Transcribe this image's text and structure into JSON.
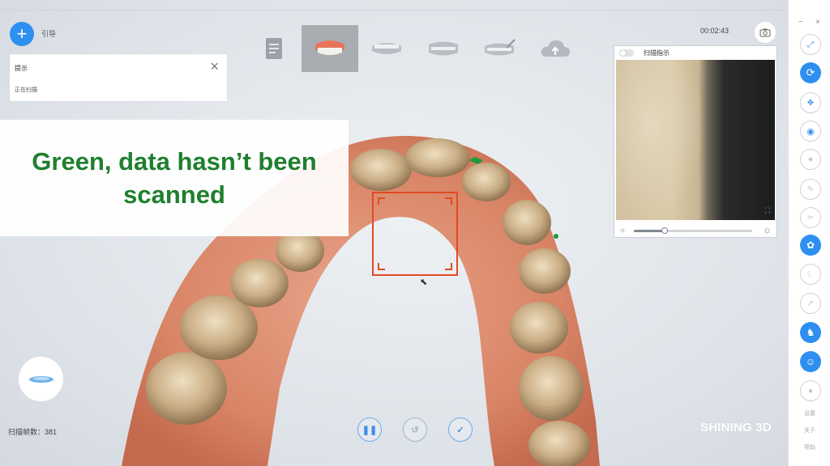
{
  "app": {
    "guide_label": "引导",
    "timer": "00:02:43",
    "brand": "SHINING 3D",
    "frame_count_label": "扫描帧数：",
    "frame_count_value": "381"
  },
  "hint_panel": {
    "title": "提示",
    "body": "正在扫描"
  },
  "caption": {
    "text": "Green, data hasn’t been scanned"
  },
  "steps": [
    {
      "name": "order-info",
      "active": false
    },
    {
      "name": "upper-jaw",
      "active": true
    },
    {
      "name": "lower-jaw",
      "active": false
    },
    {
      "name": "bite",
      "active": false
    },
    {
      "name": "edit",
      "active": false
    },
    {
      "name": "upload",
      "active": false
    }
  ],
  "preview": {
    "label": "扫描指示"
  },
  "brightness": {
    "level": 0.26
  },
  "sidebar": {
    "texts": [
      "设置",
      "关于",
      "帮助"
    ]
  },
  "colors": {
    "accent": "#2f8ff0",
    "caption_green": "#1f7f2e",
    "scan_frame": "#e04a22"
  }
}
